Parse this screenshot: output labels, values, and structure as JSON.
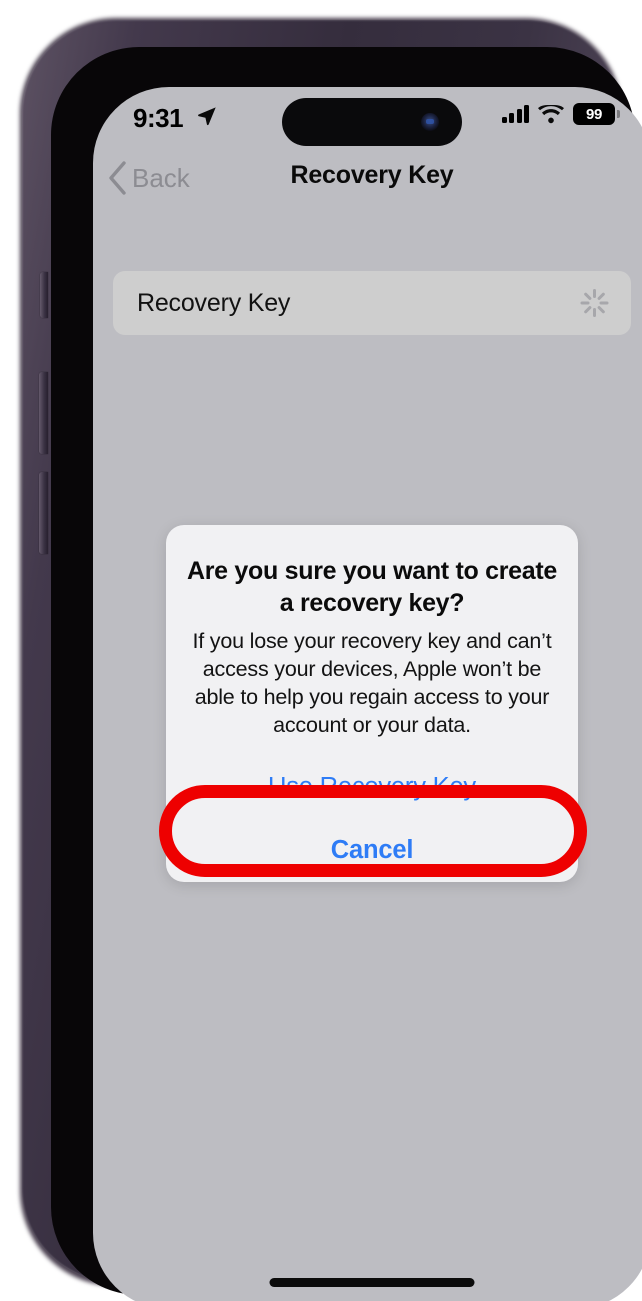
{
  "device": {
    "name": "iphone-14-pro",
    "frame_color": "#3b3344",
    "screen_bg": "#bdbdc2",
    "buttons": {
      "mute_switch": "mute-switch",
      "volume_up": "volume-up-button",
      "volume_down": "volume-down-button",
      "power": "power-button"
    },
    "home_indicator": "home-indicator"
  },
  "status_bar": {
    "time": "9:31",
    "location_icon": "location-arrow-icon",
    "cellular_icon": "cellular-signal-icon",
    "wifi_icon": "wifi-icon",
    "battery_level": "99",
    "battery_icon": "battery-icon"
  },
  "nav_bar": {
    "back_label": "Back",
    "back_icon": "chevron-left-icon",
    "title": "Recovery Key"
  },
  "content": {
    "row": {
      "label": "Recovery Key",
      "accessory_icon": "activity-spinner-icon"
    }
  },
  "alert": {
    "title": "Are you sure you want to create a recovery key?",
    "message": "If you lose your recovery key and can’t access your devices, Apple won’t be able to help you regain access to your account or your data.",
    "buttons": [
      {
        "label": "Use Recovery Key",
        "style": "default"
      },
      {
        "label": "Cancel",
        "style": "cancel"
      }
    ]
  },
  "annotation": {
    "type": "highlight-ellipse",
    "color": "#ee0000",
    "targets": "Use Recovery Key"
  },
  "colors": {
    "accent_blue": "#2e7cf6",
    "annotation_red": "#ee0000",
    "alert_bg": "#f1f1f3",
    "row_bg": "#cecece",
    "screen_bg": "#bdbdc2",
    "back_gray": "#8c8c92"
  }
}
